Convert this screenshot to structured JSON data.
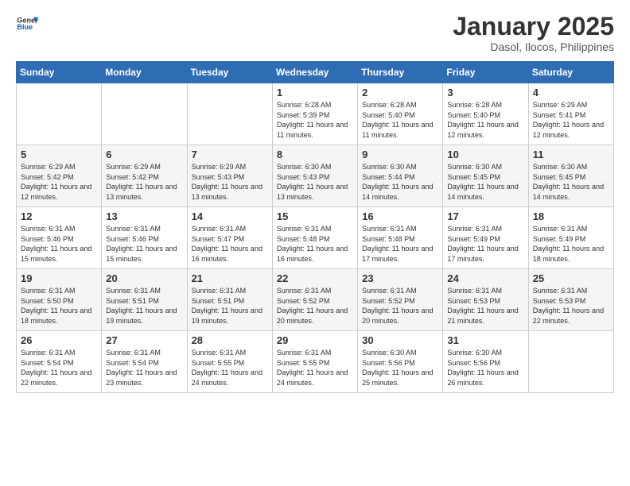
{
  "logo": {
    "general": "General",
    "blue": "Blue"
  },
  "title": "January 2025",
  "subtitle": "Dasol, Ilocos, Philippines",
  "weekdays": [
    "Sunday",
    "Monday",
    "Tuesday",
    "Wednesday",
    "Thursday",
    "Friday",
    "Saturday"
  ],
  "weeks": [
    [
      {
        "day": "",
        "sunrise": "",
        "sunset": "",
        "daylight": ""
      },
      {
        "day": "",
        "sunrise": "",
        "sunset": "",
        "daylight": ""
      },
      {
        "day": "",
        "sunrise": "",
        "sunset": "",
        "daylight": ""
      },
      {
        "day": "1",
        "sunrise": "Sunrise: 6:28 AM",
        "sunset": "Sunset: 5:39 PM",
        "daylight": "Daylight: 11 hours and 11 minutes."
      },
      {
        "day": "2",
        "sunrise": "Sunrise: 6:28 AM",
        "sunset": "Sunset: 5:40 PM",
        "daylight": "Daylight: 11 hours and 11 minutes."
      },
      {
        "day": "3",
        "sunrise": "Sunrise: 6:28 AM",
        "sunset": "Sunset: 5:40 PM",
        "daylight": "Daylight: 11 hours and 12 minutes."
      },
      {
        "day": "4",
        "sunrise": "Sunrise: 6:29 AM",
        "sunset": "Sunset: 5:41 PM",
        "daylight": "Daylight: 11 hours and 12 minutes."
      }
    ],
    [
      {
        "day": "5",
        "sunrise": "Sunrise: 6:29 AM",
        "sunset": "Sunset: 5:42 PM",
        "daylight": "Daylight: 11 hours and 12 minutes."
      },
      {
        "day": "6",
        "sunrise": "Sunrise: 6:29 AM",
        "sunset": "Sunset: 5:42 PM",
        "daylight": "Daylight: 11 hours and 13 minutes."
      },
      {
        "day": "7",
        "sunrise": "Sunrise: 6:29 AM",
        "sunset": "Sunset: 5:43 PM",
        "daylight": "Daylight: 11 hours and 13 minutes."
      },
      {
        "day": "8",
        "sunrise": "Sunrise: 6:30 AM",
        "sunset": "Sunset: 5:43 PM",
        "daylight": "Daylight: 11 hours and 13 minutes."
      },
      {
        "day": "9",
        "sunrise": "Sunrise: 6:30 AM",
        "sunset": "Sunset: 5:44 PM",
        "daylight": "Daylight: 11 hours and 14 minutes."
      },
      {
        "day": "10",
        "sunrise": "Sunrise: 6:30 AM",
        "sunset": "Sunset: 5:45 PM",
        "daylight": "Daylight: 11 hours and 14 minutes."
      },
      {
        "day": "11",
        "sunrise": "Sunrise: 6:30 AM",
        "sunset": "Sunset: 5:45 PM",
        "daylight": "Daylight: 11 hours and 14 minutes."
      }
    ],
    [
      {
        "day": "12",
        "sunrise": "Sunrise: 6:31 AM",
        "sunset": "Sunset: 5:46 PM",
        "daylight": "Daylight: 11 hours and 15 minutes."
      },
      {
        "day": "13",
        "sunrise": "Sunrise: 6:31 AM",
        "sunset": "Sunset: 5:46 PM",
        "daylight": "Daylight: 11 hours and 15 minutes."
      },
      {
        "day": "14",
        "sunrise": "Sunrise: 6:31 AM",
        "sunset": "Sunset: 5:47 PM",
        "daylight": "Daylight: 11 hours and 16 minutes."
      },
      {
        "day": "15",
        "sunrise": "Sunrise: 6:31 AM",
        "sunset": "Sunset: 5:48 PM",
        "daylight": "Daylight: 11 hours and 16 minutes."
      },
      {
        "day": "16",
        "sunrise": "Sunrise: 6:31 AM",
        "sunset": "Sunset: 5:48 PM",
        "daylight": "Daylight: 11 hours and 17 minutes."
      },
      {
        "day": "17",
        "sunrise": "Sunrise: 6:31 AM",
        "sunset": "Sunset: 5:49 PM",
        "daylight": "Daylight: 11 hours and 17 minutes."
      },
      {
        "day": "18",
        "sunrise": "Sunrise: 6:31 AM",
        "sunset": "Sunset: 5:49 PM",
        "daylight": "Daylight: 11 hours and 18 minutes."
      }
    ],
    [
      {
        "day": "19",
        "sunrise": "Sunrise: 6:31 AM",
        "sunset": "Sunset: 5:50 PM",
        "daylight": "Daylight: 11 hours and 18 minutes."
      },
      {
        "day": "20",
        "sunrise": "Sunrise: 6:31 AM",
        "sunset": "Sunset: 5:51 PM",
        "daylight": "Daylight: 11 hours and 19 minutes."
      },
      {
        "day": "21",
        "sunrise": "Sunrise: 6:31 AM",
        "sunset": "Sunset: 5:51 PM",
        "daylight": "Daylight: 11 hours and 19 minutes."
      },
      {
        "day": "22",
        "sunrise": "Sunrise: 6:31 AM",
        "sunset": "Sunset: 5:52 PM",
        "daylight": "Daylight: 11 hours and 20 minutes."
      },
      {
        "day": "23",
        "sunrise": "Sunrise: 6:31 AM",
        "sunset": "Sunset: 5:52 PM",
        "daylight": "Daylight: 11 hours and 20 minutes."
      },
      {
        "day": "24",
        "sunrise": "Sunrise: 6:31 AM",
        "sunset": "Sunset: 5:53 PM",
        "daylight": "Daylight: 11 hours and 21 minutes."
      },
      {
        "day": "25",
        "sunrise": "Sunrise: 6:31 AM",
        "sunset": "Sunset: 5:53 PM",
        "daylight": "Daylight: 11 hours and 22 minutes."
      }
    ],
    [
      {
        "day": "26",
        "sunrise": "Sunrise: 6:31 AM",
        "sunset": "Sunset: 5:54 PM",
        "daylight": "Daylight: 11 hours and 22 minutes."
      },
      {
        "day": "27",
        "sunrise": "Sunrise: 6:31 AM",
        "sunset": "Sunset: 5:54 PM",
        "daylight": "Daylight: 11 hours and 23 minutes."
      },
      {
        "day": "28",
        "sunrise": "Sunrise: 6:31 AM",
        "sunset": "Sunset: 5:55 PM",
        "daylight": "Daylight: 11 hours and 24 minutes."
      },
      {
        "day": "29",
        "sunrise": "Sunrise: 6:31 AM",
        "sunset": "Sunset: 5:55 PM",
        "daylight": "Daylight: 11 hours and 24 minutes."
      },
      {
        "day": "30",
        "sunrise": "Sunrise: 6:30 AM",
        "sunset": "Sunset: 5:56 PM",
        "daylight": "Daylight: 11 hours and 25 minutes."
      },
      {
        "day": "31",
        "sunrise": "Sunrise: 6:30 AM",
        "sunset": "Sunset: 5:56 PM",
        "daylight": "Daylight: 11 hours and 26 minutes."
      },
      {
        "day": "",
        "sunrise": "",
        "sunset": "",
        "daylight": ""
      }
    ]
  ]
}
